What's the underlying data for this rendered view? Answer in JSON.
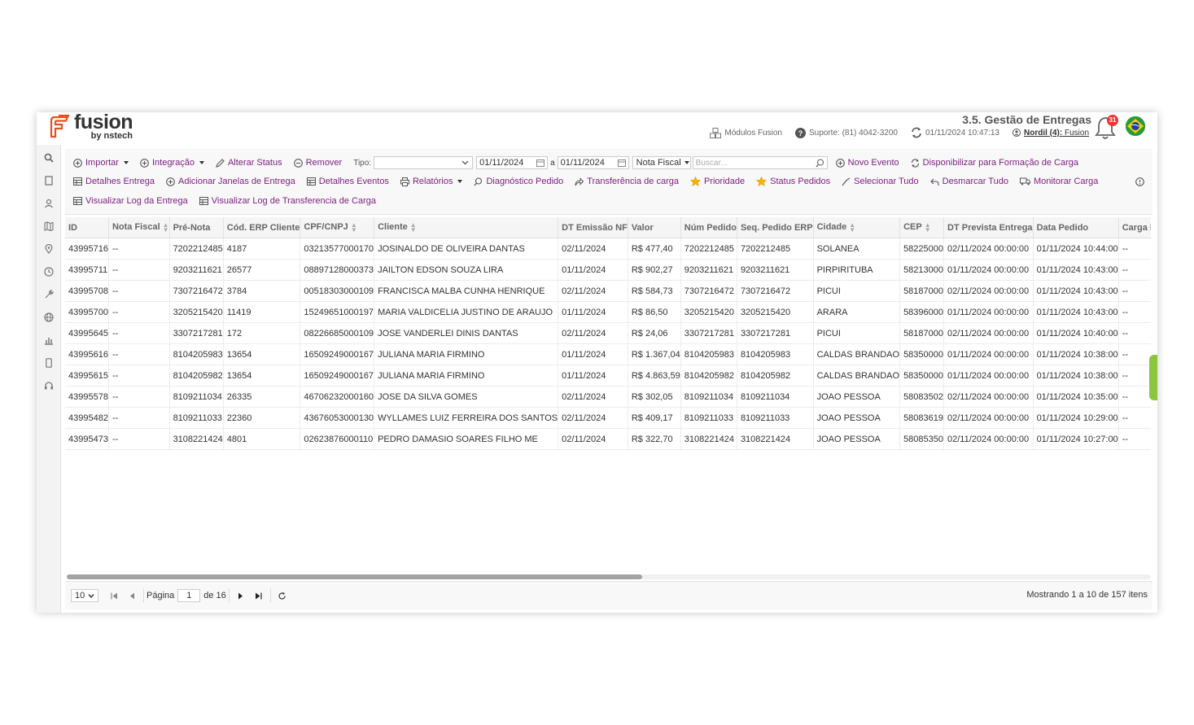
{
  "brand": {
    "name": "fusion",
    "byline": "by nstech",
    "accent": "#7a1e7e",
    "logo_color": "#e8501f"
  },
  "header": {
    "page_title": "3.5. Gestão de Entregas",
    "modules_label": "Módulos Fusion",
    "support_label": "Suporte: (81) 4042-3200",
    "refresh_datetime": "01/11/2024 10:47:13",
    "user_name": "Nordil (4):",
    "user_company": "Fusion",
    "notification_count": "31"
  },
  "sidebar": {
    "items": [
      "search-icon",
      "document-icon",
      "users-icon",
      "map-icon",
      "pin-icon",
      "clock-icon",
      "tools-icon",
      "globe-icon",
      "chart-icon",
      "mobile-icon",
      "headset-icon"
    ]
  },
  "toolbar": {
    "importar": "Importar",
    "integracao": "Integração",
    "alterar_status": "Alterar Status",
    "remover": "Remover",
    "tipo_label": "Tipo:",
    "tipo_value": "",
    "date_from": "01/11/2024",
    "date_sep": "a",
    "date_to": "01/11/2024",
    "filter_field": "Nota Fiscal",
    "search_placeholder": "Buscar...",
    "novo_evento": "Novo Evento",
    "disponibilizar": "Disponibilizar para Formação de Carga",
    "detalhes_entrega": "Detalhes Entrega",
    "adicionar_janelas": "Adicionar Janelas de Entrega",
    "detalhes_eventos": "Detalhes Eventos",
    "relatorios": "Relatórios",
    "diagnostico": "Diagnóstico Pedido",
    "transferencia": "Transferência de carga",
    "prioridade": "Prioridade",
    "status_pedidos": "Status Pedidos",
    "selecionar_tudo": "Selecionar Tudo",
    "desmarcar_tudo": "Desmarcar Tudo",
    "monitorar_carga": "Monitorar Carga",
    "visualizar_log": "Visualizar Log da Entrega",
    "visualizar_log_transf": "Visualizar Log de Transferencia de Carga"
  },
  "table": {
    "columns": [
      "ID",
      "Nota Fiscal",
      "Pré-Nota",
      "Cód. ERP Cliente",
      "CPF/CNPJ",
      "Cliente",
      "DT Emissão NF",
      "Valor",
      "Núm Pedido",
      "Seq. Pedido ERP",
      "Cidade",
      "CEP",
      "DT Prevista Entrega",
      "Data Pedido",
      "Carga ERP"
    ],
    "sortable": [
      false,
      true,
      false,
      false,
      true,
      true,
      false,
      false,
      false,
      false,
      true,
      true,
      false,
      false,
      false
    ],
    "rows": [
      [
        "43995716",
        "--",
        "7202212485",
        "4187",
        "03213577000170",
        "JOSINALDO DE OLIVEIRA DANTAS",
        "02/11/2024",
        "R$ 477,40",
        "7202212485",
        "7202212485",
        "SOLANEA",
        "58225000",
        "02/11/2024 00:00:00",
        "01/11/2024 10:44:00",
        "--"
      ],
      [
        "43995711",
        "--",
        "9203211621",
        "26577",
        "08897128000373",
        "JAILTON EDSON SOUZA LIRA",
        "01/11/2024",
        "R$ 902,27",
        "9203211621",
        "9203211621",
        "PIRPIRITUBA",
        "58213000",
        "01/11/2024 00:00:00",
        "01/11/2024 10:43:00",
        "--"
      ],
      [
        "43995708",
        "--",
        "7307216472",
        "3784",
        "00518303000109",
        "FRANCISCA MALBA CUNHA HENRIQUE",
        "02/11/2024",
        "R$ 584,73",
        "7307216472",
        "7307216472",
        "PICUI",
        "58187000",
        "02/11/2024 00:00:00",
        "01/11/2024 10:43:00",
        "--"
      ],
      [
        "43995700",
        "--",
        "3205215420",
        "11419",
        "15249651000197",
        "MARIA VALDICELIA JUSTINO DE ARAUJO",
        "01/11/2024",
        "R$ 86,50",
        "3205215420",
        "3205215420",
        "ARARA",
        "58396000",
        "01/11/2024 00:00:00",
        "01/11/2024 10:43:00",
        "--"
      ],
      [
        "43995645",
        "--",
        "3307217281",
        "172",
        "08226685000109",
        "JOSE VANDERLEI DINIS DANTAS",
        "02/11/2024",
        "R$ 24,06",
        "3307217281",
        "3307217281",
        "PICUI",
        "58187000",
        "02/11/2024 00:00:00",
        "01/11/2024 10:40:00",
        "--"
      ],
      [
        "43995616",
        "--",
        "8104205983",
        "13654",
        "16509249000167",
        "JULIANA MARIA FIRMINO",
        "01/11/2024",
        "R$ 1.367,04",
        "8104205983",
        "8104205983",
        "CALDAS BRANDAO",
        "58350000",
        "01/11/2024 00:00:00",
        "01/11/2024 10:38:00",
        "--"
      ],
      [
        "43995615",
        "--",
        "8104205982",
        "13654",
        "16509249000167",
        "JULIANA MARIA FIRMINO",
        "01/11/2024",
        "R$ 4.863,59",
        "8104205982",
        "8104205982",
        "CALDAS BRANDAO",
        "58350000",
        "01/11/2024 00:00:00",
        "01/11/2024 10:38:00",
        "--"
      ],
      [
        "43995578",
        "--",
        "8109211034",
        "26335",
        "46706232000160",
        "JOSE DA SILVA GOMES",
        "02/11/2024",
        "R$ 302,05",
        "8109211034",
        "8109211034",
        "JOAO PESSOA",
        "58083502",
        "02/11/2024 00:00:00",
        "01/11/2024 10:35:00",
        "--"
      ],
      [
        "43995482",
        "--",
        "8109211033",
        "22360",
        "43676053000130",
        "WYLLAMES LUIZ FERREIRA DOS SANTOS",
        "02/11/2024",
        "R$ 409,17",
        "8109211033",
        "8109211033",
        "JOAO PESSOA",
        "58083619",
        "02/11/2024 00:00:00",
        "01/11/2024 10:29:00",
        "--"
      ],
      [
        "43995473",
        "--",
        "3108221424",
        "4801",
        "02623876000110",
        "PEDRO DAMASIO SOARES FILHO ME",
        "02/11/2024",
        "R$ 322,70",
        "3108221424",
        "3108221424",
        "JOAO PESSOA",
        "58085350",
        "02/11/2024 00:00:00",
        "01/11/2024 10:27:00",
        "--"
      ]
    ]
  },
  "pager": {
    "page_size": "10",
    "page_label": "Página",
    "current_page": "1",
    "of_label": "de 16",
    "info": "Mostrando 1 a 10 de 157 itens"
  }
}
